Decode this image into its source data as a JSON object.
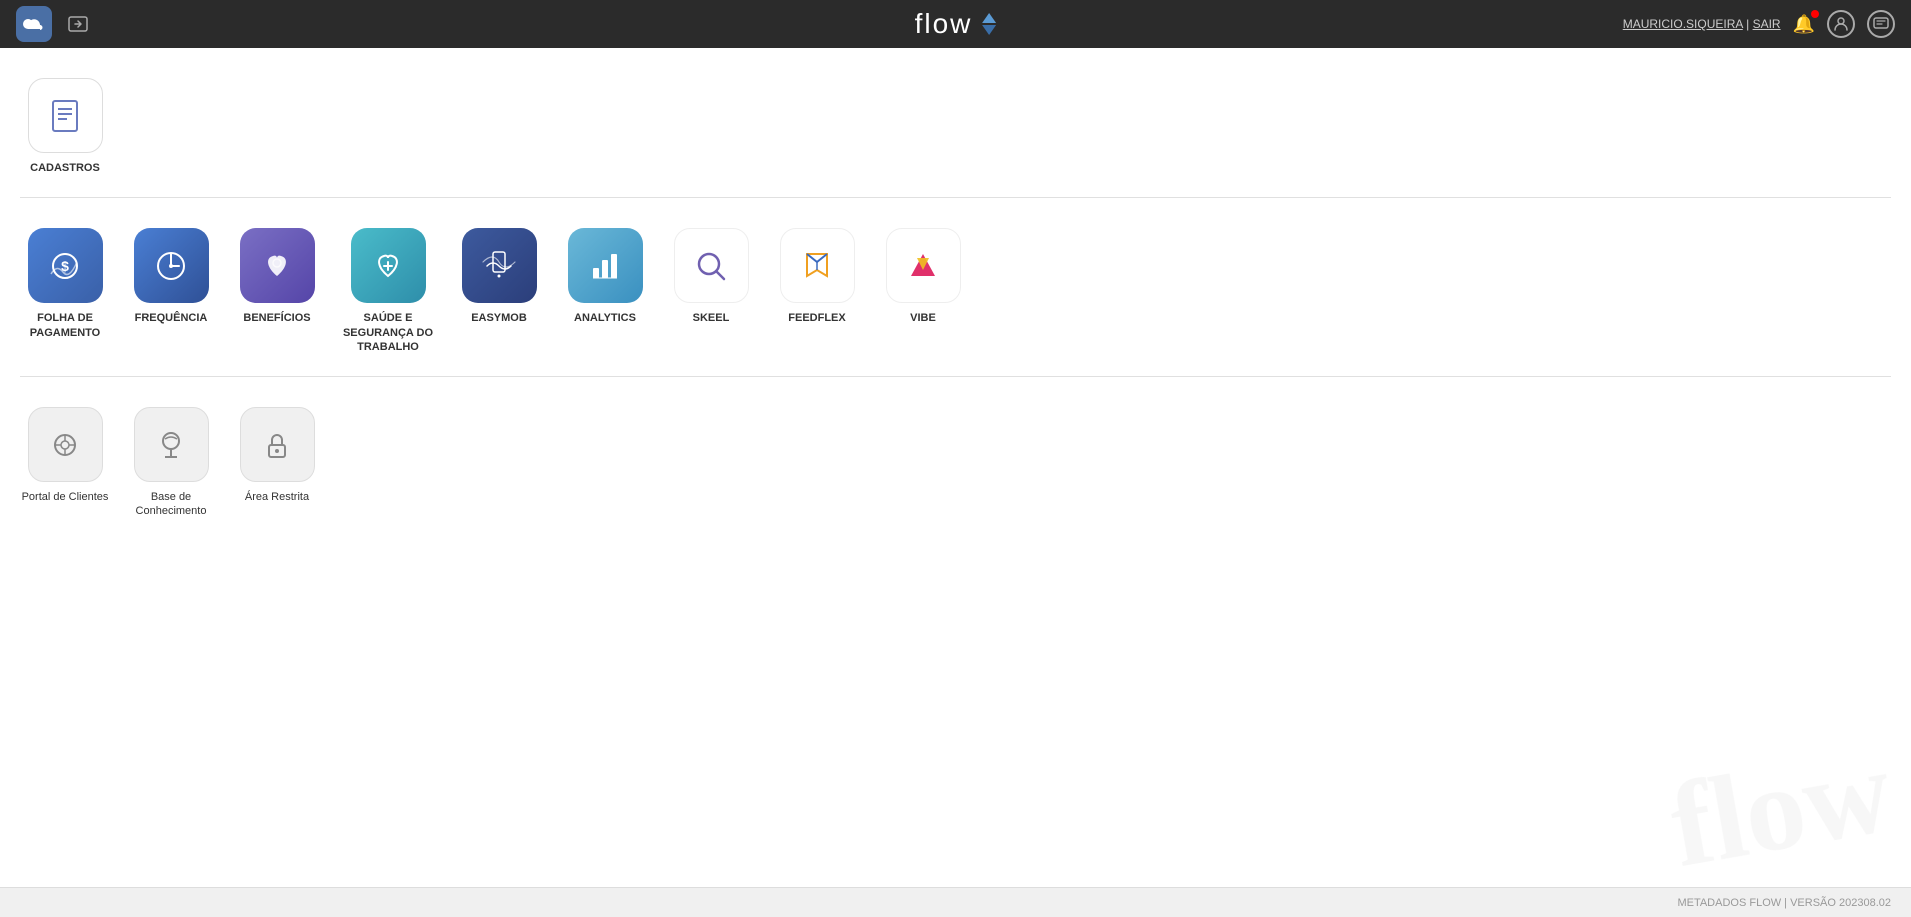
{
  "header": {
    "logo_text": "flow",
    "user_name": "MAURICIO.SIQUEIRA",
    "separator": "|",
    "logout_label": "SAIR"
  },
  "sections": {
    "cadastros": {
      "label": "CADASTROS"
    },
    "apps": {
      "items": [
        {
          "id": "folha",
          "label": "FOLHA DE PAGAMENTO",
          "color": "blue",
          "icon": "dollar"
        },
        {
          "id": "frequencia",
          "label": "FREQUÊNCIA",
          "color": "blue2",
          "icon": "clock"
        },
        {
          "id": "beneficios",
          "label": "BENEFÍCIOS",
          "color": "purple",
          "icon": "heart"
        },
        {
          "id": "saude",
          "label": "SAÚDE E SEGURANÇA DO TRABALHO",
          "color": "teal",
          "icon": "heartbeat"
        },
        {
          "id": "easymob",
          "label": "EASYMOB",
          "color": "darkblue",
          "icon": "mobile"
        },
        {
          "id": "analytics",
          "label": "ANALYTICS",
          "color": "lightblue",
          "icon": "chart"
        },
        {
          "id": "skeel",
          "label": "SKEEL",
          "color": "white",
          "icon": "magnifier"
        },
        {
          "id": "feedflex",
          "label": "FEEDFLEX",
          "color": "white",
          "icon": "feather"
        },
        {
          "id": "vibe",
          "label": "VIBE",
          "color": "white",
          "icon": "triangle"
        }
      ]
    },
    "others": {
      "items": [
        {
          "id": "portal",
          "label": "Portal de Clientes",
          "color": "gray",
          "icon": "gear"
        },
        {
          "id": "base",
          "label": "Base de Conhecimento",
          "color": "gray",
          "icon": "graduation"
        },
        {
          "id": "restrita",
          "label": "Área Restrita",
          "color": "gray",
          "icon": "lock"
        }
      ]
    }
  },
  "footer": {
    "text": "METADADOS FLOW | VERSÃO 202308.02"
  }
}
